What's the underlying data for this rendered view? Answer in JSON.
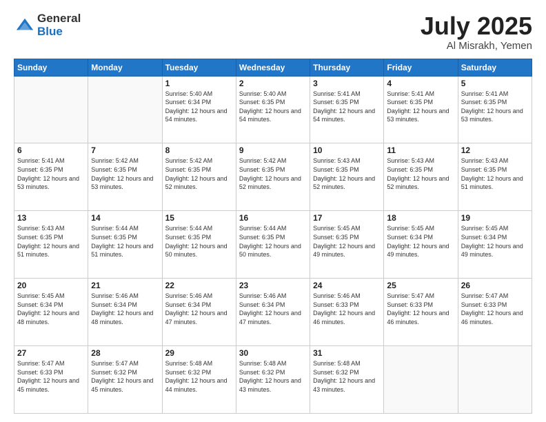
{
  "logo": {
    "general": "General",
    "blue": "Blue"
  },
  "title": "July 2025",
  "subtitle": "Al Misrakh, Yemen",
  "days_header": [
    "Sunday",
    "Monday",
    "Tuesday",
    "Wednesday",
    "Thursday",
    "Friday",
    "Saturday"
  ],
  "weeks": [
    [
      {
        "day": "",
        "sunrise": "",
        "sunset": "",
        "daylight": ""
      },
      {
        "day": "",
        "sunrise": "",
        "sunset": "",
        "daylight": ""
      },
      {
        "day": "1",
        "sunrise": "Sunrise: 5:40 AM",
        "sunset": "Sunset: 6:34 PM",
        "daylight": "Daylight: 12 hours and 54 minutes."
      },
      {
        "day": "2",
        "sunrise": "Sunrise: 5:40 AM",
        "sunset": "Sunset: 6:35 PM",
        "daylight": "Daylight: 12 hours and 54 minutes."
      },
      {
        "day": "3",
        "sunrise": "Sunrise: 5:41 AM",
        "sunset": "Sunset: 6:35 PM",
        "daylight": "Daylight: 12 hours and 54 minutes."
      },
      {
        "day": "4",
        "sunrise": "Sunrise: 5:41 AM",
        "sunset": "Sunset: 6:35 PM",
        "daylight": "Daylight: 12 hours and 53 minutes."
      },
      {
        "day": "5",
        "sunrise": "Sunrise: 5:41 AM",
        "sunset": "Sunset: 6:35 PM",
        "daylight": "Daylight: 12 hours and 53 minutes."
      }
    ],
    [
      {
        "day": "6",
        "sunrise": "Sunrise: 5:41 AM",
        "sunset": "Sunset: 6:35 PM",
        "daylight": "Daylight: 12 hours and 53 minutes."
      },
      {
        "day": "7",
        "sunrise": "Sunrise: 5:42 AM",
        "sunset": "Sunset: 6:35 PM",
        "daylight": "Daylight: 12 hours and 53 minutes."
      },
      {
        "day": "8",
        "sunrise": "Sunrise: 5:42 AM",
        "sunset": "Sunset: 6:35 PM",
        "daylight": "Daylight: 12 hours and 52 minutes."
      },
      {
        "day": "9",
        "sunrise": "Sunrise: 5:42 AM",
        "sunset": "Sunset: 6:35 PM",
        "daylight": "Daylight: 12 hours and 52 minutes."
      },
      {
        "day": "10",
        "sunrise": "Sunrise: 5:43 AM",
        "sunset": "Sunset: 6:35 PM",
        "daylight": "Daylight: 12 hours and 52 minutes."
      },
      {
        "day": "11",
        "sunrise": "Sunrise: 5:43 AM",
        "sunset": "Sunset: 6:35 PM",
        "daylight": "Daylight: 12 hours and 52 minutes."
      },
      {
        "day": "12",
        "sunrise": "Sunrise: 5:43 AM",
        "sunset": "Sunset: 6:35 PM",
        "daylight": "Daylight: 12 hours and 51 minutes."
      }
    ],
    [
      {
        "day": "13",
        "sunrise": "Sunrise: 5:43 AM",
        "sunset": "Sunset: 6:35 PM",
        "daylight": "Daylight: 12 hours and 51 minutes."
      },
      {
        "day": "14",
        "sunrise": "Sunrise: 5:44 AM",
        "sunset": "Sunset: 6:35 PM",
        "daylight": "Daylight: 12 hours and 51 minutes."
      },
      {
        "day": "15",
        "sunrise": "Sunrise: 5:44 AM",
        "sunset": "Sunset: 6:35 PM",
        "daylight": "Daylight: 12 hours and 50 minutes."
      },
      {
        "day": "16",
        "sunrise": "Sunrise: 5:44 AM",
        "sunset": "Sunset: 6:35 PM",
        "daylight": "Daylight: 12 hours and 50 minutes."
      },
      {
        "day": "17",
        "sunrise": "Sunrise: 5:45 AM",
        "sunset": "Sunset: 6:35 PM",
        "daylight": "Daylight: 12 hours and 49 minutes."
      },
      {
        "day": "18",
        "sunrise": "Sunrise: 5:45 AM",
        "sunset": "Sunset: 6:34 PM",
        "daylight": "Daylight: 12 hours and 49 minutes."
      },
      {
        "day": "19",
        "sunrise": "Sunrise: 5:45 AM",
        "sunset": "Sunset: 6:34 PM",
        "daylight": "Daylight: 12 hours and 49 minutes."
      }
    ],
    [
      {
        "day": "20",
        "sunrise": "Sunrise: 5:45 AM",
        "sunset": "Sunset: 6:34 PM",
        "daylight": "Daylight: 12 hours and 48 minutes."
      },
      {
        "day": "21",
        "sunrise": "Sunrise: 5:46 AM",
        "sunset": "Sunset: 6:34 PM",
        "daylight": "Daylight: 12 hours and 48 minutes."
      },
      {
        "day": "22",
        "sunrise": "Sunrise: 5:46 AM",
        "sunset": "Sunset: 6:34 PM",
        "daylight": "Daylight: 12 hours and 47 minutes."
      },
      {
        "day": "23",
        "sunrise": "Sunrise: 5:46 AM",
        "sunset": "Sunset: 6:34 PM",
        "daylight": "Daylight: 12 hours and 47 minutes."
      },
      {
        "day": "24",
        "sunrise": "Sunrise: 5:46 AM",
        "sunset": "Sunset: 6:33 PM",
        "daylight": "Daylight: 12 hours and 46 minutes."
      },
      {
        "day": "25",
        "sunrise": "Sunrise: 5:47 AM",
        "sunset": "Sunset: 6:33 PM",
        "daylight": "Daylight: 12 hours and 46 minutes."
      },
      {
        "day": "26",
        "sunrise": "Sunrise: 5:47 AM",
        "sunset": "Sunset: 6:33 PM",
        "daylight": "Daylight: 12 hours and 46 minutes."
      }
    ],
    [
      {
        "day": "27",
        "sunrise": "Sunrise: 5:47 AM",
        "sunset": "Sunset: 6:33 PM",
        "daylight": "Daylight: 12 hours and 45 minutes."
      },
      {
        "day": "28",
        "sunrise": "Sunrise: 5:47 AM",
        "sunset": "Sunset: 6:32 PM",
        "daylight": "Daylight: 12 hours and 45 minutes."
      },
      {
        "day": "29",
        "sunrise": "Sunrise: 5:48 AM",
        "sunset": "Sunset: 6:32 PM",
        "daylight": "Daylight: 12 hours and 44 minutes."
      },
      {
        "day": "30",
        "sunrise": "Sunrise: 5:48 AM",
        "sunset": "Sunset: 6:32 PM",
        "daylight": "Daylight: 12 hours and 43 minutes."
      },
      {
        "day": "31",
        "sunrise": "Sunrise: 5:48 AM",
        "sunset": "Sunset: 6:32 PM",
        "daylight": "Daylight: 12 hours and 43 minutes."
      },
      {
        "day": "",
        "sunrise": "",
        "sunset": "",
        "daylight": ""
      },
      {
        "day": "",
        "sunrise": "",
        "sunset": "",
        "daylight": ""
      }
    ]
  ]
}
